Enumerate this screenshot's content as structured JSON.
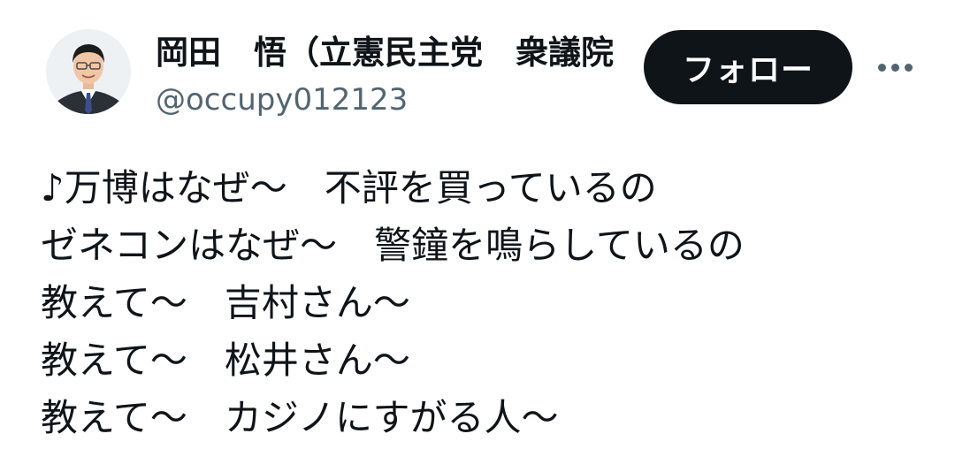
{
  "author": {
    "display_name": "岡田　悟（立憲民主党　衆議院",
    "handle": "@occupy012123",
    "avatar_icon": "profile-photo"
  },
  "actions": {
    "follow_label": "フォロー",
    "more_icon": "more-horizontal-icon"
  },
  "tweet": {
    "lines": [
      "♪万博はなぜ～　不評を買っているの",
      "ゼネコンはなぜ～　警鐘を鳴らしているの",
      "教えて～　吉村さん～",
      "教えて～　松井さん～",
      "教えて～　カジノにすがる人～"
    ]
  },
  "colors": {
    "text": "#0f1419",
    "secondary_text": "#536471",
    "follow_button_bg": "#0f1419",
    "follow_button_text": "#ffffff"
  }
}
